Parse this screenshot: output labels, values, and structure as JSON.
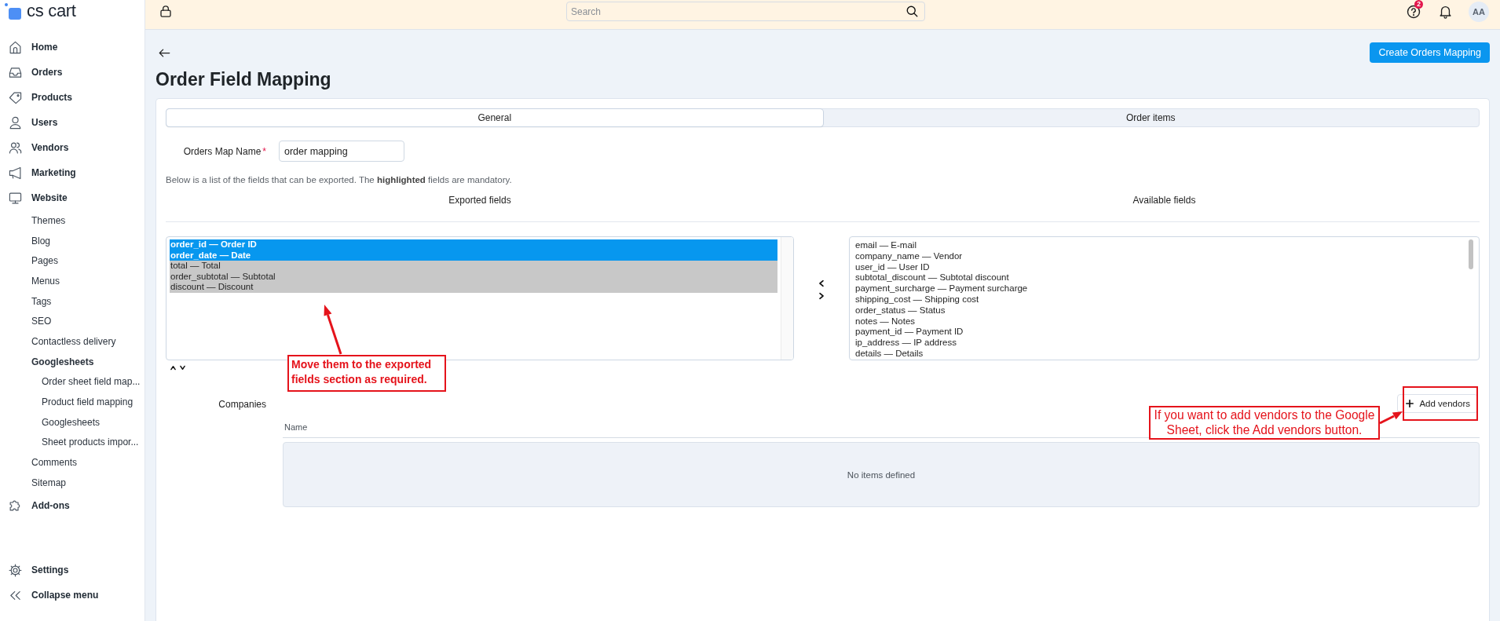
{
  "sidebar": {
    "logo": "cs cart",
    "items": [
      {
        "label": "Home"
      },
      {
        "label": "Orders"
      },
      {
        "label": "Products"
      },
      {
        "label": "Users"
      },
      {
        "label": "Vendors"
      },
      {
        "label": "Marketing"
      },
      {
        "label": "Website",
        "children": [
          {
            "label": "Themes"
          },
          {
            "label": "Blog"
          },
          {
            "label": "Pages"
          },
          {
            "label": "Menus"
          },
          {
            "label": "Tags"
          },
          {
            "label": "SEO"
          },
          {
            "label": "Contactless delivery"
          },
          {
            "label": "Googlesheets",
            "children": [
              {
                "label": "Order sheet field map..."
              },
              {
                "label": "Product field mapping"
              },
              {
                "label": "Googlesheets"
              },
              {
                "label": "Sheet products impor..."
              }
            ]
          },
          {
            "label": "Comments"
          },
          {
            "label": "Sitemap"
          }
        ]
      },
      {
        "label": "Add-ons"
      }
    ],
    "footer_items": [
      {
        "label": "Settings"
      },
      {
        "label": "Collapse menu"
      }
    ]
  },
  "top_bar": {
    "search": {
      "placeholder": "Search"
    },
    "help_badge": "2",
    "avatar": "AA"
  },
  "header": {
    "title": "Order Field Mapping",
    "create_button": "Create Orders Mapping"
  },
  "tabs": [
    {
      "label": "General",
      "selected": true
    },
    {
      "label": "Order items",
      "selected": false
    }
  ],
  "map_name": {
    "label": "Orders Map Name",
    "required_mark": "*",
    "value": "order mapping"
  },
  "note": "Below is a list of the fields that can be exported. The **highlighted** fields are mandatory.",
  "exported_fields": {
    "heading": "Exported fields",
    "items": [
      {
        "label": "order_id — Order ID",
        "mandatory": true,
        "selected": true
      },
      {
        "label": "order_date — Date",
        "mandatory": true,
        "selected": true
      },
      {
        "label": "total — Total",
        "mandatory": false,
        "selected": true
      },
      {
        "label": "order_subtotal — Subtotal",
        "mandatory": false,
        "selected": true
      },
      {
        "label": "discount — Discount",
        "mandatory": false,
        "selected": true
      }
    ]
  },
  "available_fields": {
    "heading": "Available fields",
    "items": [
      {
        "label": "email — E-mail",
        "selected": false
      },
      {
        "label": "company_name — Vendor",
        "selected": false
      },
      {
        "label": "user_id — User ID",
        "selected": false
      },
      {
        "label": "subtotal_discount — Subtotal discount",
        "selected": false
      },
      {
        "label": "payment_surcharge — Payment surcharge",
        "selected": false
      },
      {
        "label": "shipping_cost — Shipping cost",
        "selected": false
      },
      {
        "label": "order_status — Status",
        "selected": false
      },
      {
        "label": "notes — Notes",
        "selected": false
      },
      {
        "label": "payment_id — Payment ID",
        "selected": false
      },
      {
        "label": "ip_address — IP address",
        "selected": false
      },
      {
        "label": "details — Details",
        "selected": false
      }
    ]
  },
  "companies": {
    "label": "Companies",
    "add_button": "Add vendors",
    "columns": [
      "Name"
    ],
    "empty_text": "No items defined"
  },
  "annotations": [
    {
      "text": "Move them to the exported fields section as required."
    },
    {
      "text": "If you want to add vendors to the Google Sheet, click the Add vendors button."
    }
  ]
}
